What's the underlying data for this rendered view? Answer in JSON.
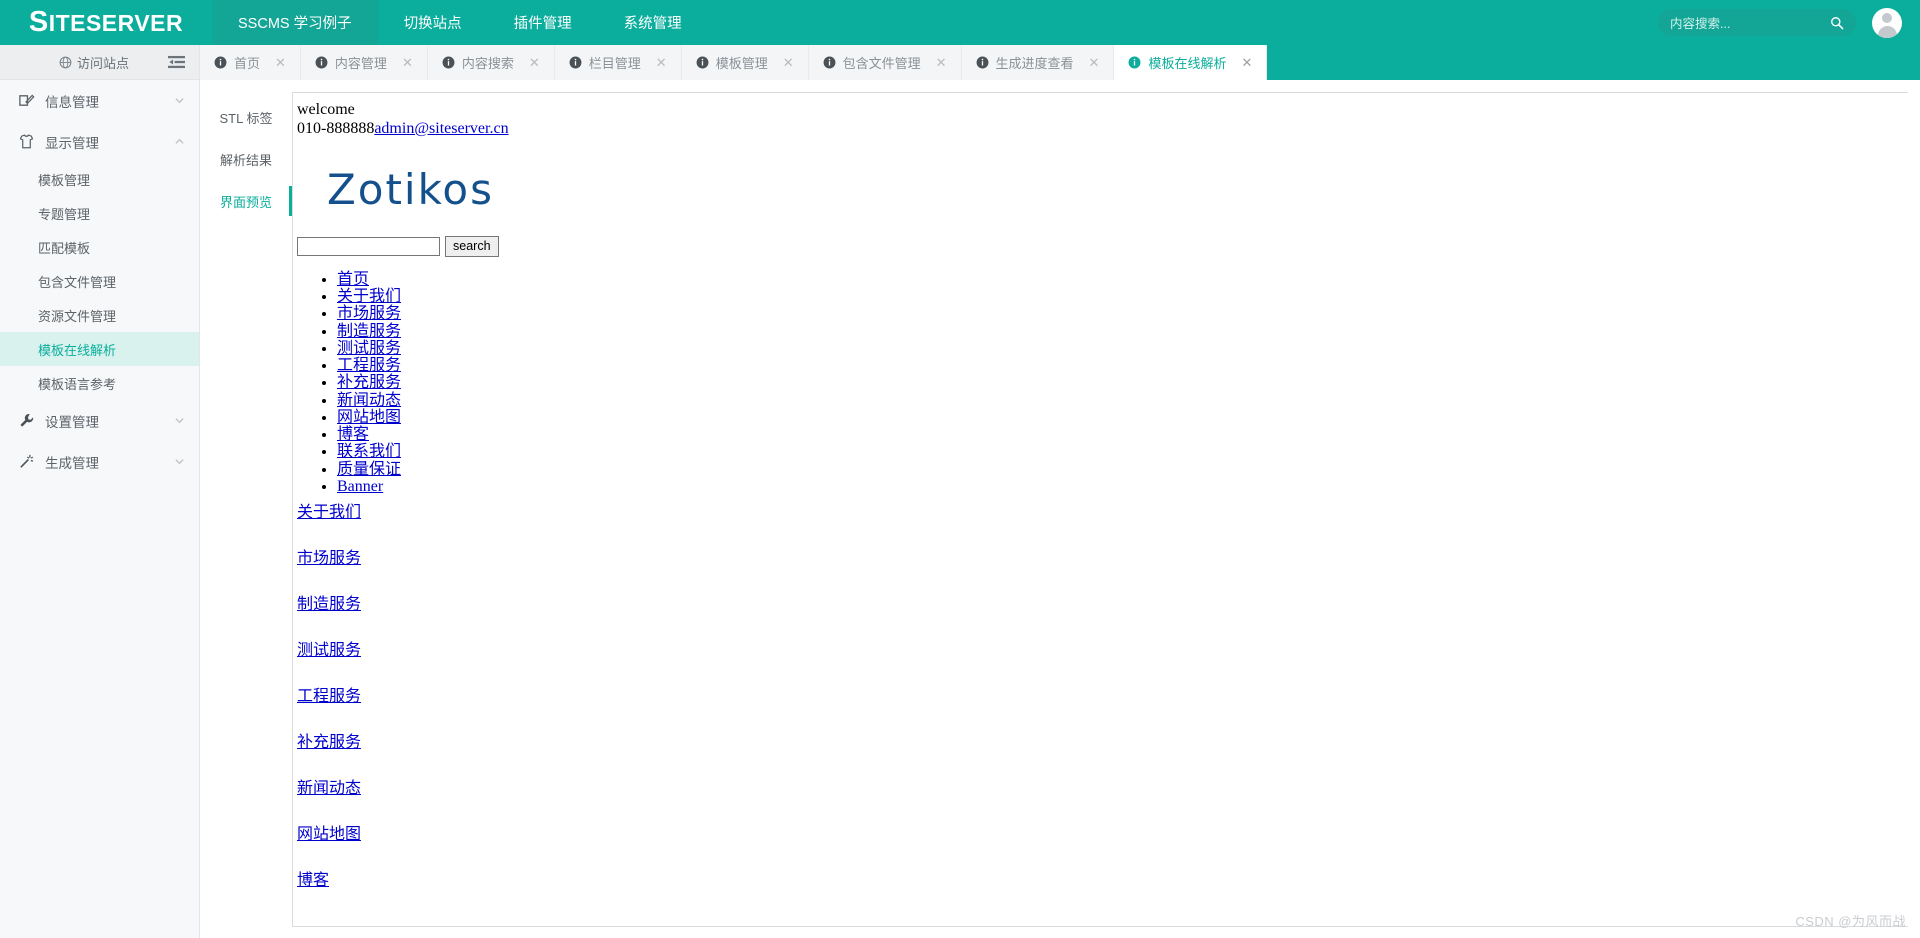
{
  "topbar": {
    "logo": "SITESERVER",
    "logo_first": "S",
    "logo_rest": "ITESERVER",
    "nav": [
      {
        "label": "SSCMS 学习例子",
        "active": true
      },
      {
        "label": "切换站点",
        "active": false
      },
      {
        "label": "插件管理",
        "active": false
      },
      {
        "label": "系统管理",
        "active": false
      }
    ],
    "search_placeholder": "内容搜索...",
    "search_icon": "search-icon",
    "avatar_icon": "avatar-icon"
  },
  "sidebar": {
    "visit_site": "访问站点",
    "visit_icon": "globe-icon",
    "collapse_icon": "collapse-menu-icon",
    "groups": [
      {
        "label": "信息管理",
        "icon": "edit-square-icon",
        "expanded": false,
        "chevron": "chevron-down-icon",
        "items": []
      },
      {
        "label": "显示管理",
        "icon": "shirt-icon",
        "expanded": true,
        "chevron": "chevron-up-icon",
        "items": [
          {
            "label": "模板管理",
            "active": false
          },
          {
            "label": "专题管理",
            "active": false
          },
          {
            "label": "匹配模板",
            "active": false
          },
          {
            "label": "包含文件管理",
            "active": false
          },
          {
            "label": "资源文件管理",
            "active": false
          },
          {
            "label": "模板在线解析",
            "active": true
          },
          {
            "label": "模板语言参考",
            "active": false
          }
        ]
      },
      {
        "label": "设置管理",
        "icon": "wrench-icon",
        "expanded": false,
        "chevron": "chevron-down-icon",
        "items": []
      },
      {
        "label": "生成管理",
        "icon": "magic-wand-icon",
        "expanded": false,
        "chevron": "chevron-down-icon",
        "items": []
      }
    ]
  },
  "tabs": [
    {
      "label": "首页",
      "active": false
    },
    {
      "label": "内容管理",
      "active": false
    },
    {
      "label": "内容搜索",
      "active": false
    },
    {
      "label": "栏目管理",
      "active": false
    },
    {
      "label": "模板管理",
      "active": false
    },
    {
      "label": "包含文件管理",
      "active": false
    },
    {
      "label": "生成进度查看",
      "active": false
    },
    {
      "label": "模板在线解析",
      "active": true
    }
  ],
  "vtabs": [
    {
      "label": "STL 标签",
      "active": false
    },
    {
      "label": "解析结果",
      "active": false
    },
    {
      "label": "界面预览",
      "active": true
    }
  ],
  "preview": {
    "welcome": "welcome",
    "phone": "010-888888",
    "email": "admin@siteserver.cn",
    "logo": "Zotikos",
    "search_value": "",
    "search_button": "search",
    "menu_items": [
      "首页",
      "关于我们",
      "市场服务",
      "制造服务",
      "测试服务",
      "工程服务",
      "补充服务",
      "新闻动态",
      "网站地图",
      "博客",
      "联系我们",
      "质量保证",
      "Banner"
    ],
    "section_links": [
      "关于我们",
      "市场服务",
      "制造服务",
      "测试服务",
      "工程服务",
      "补充服务",
      "新闻动态",
      "网站地图",
      "博客"
    ]
  },
  "watermark": "CSDN @为风而战",
  "colors": {
    "brand_teal": "#0bae9c",
    "brand_teal_dark": "#13a596",
    "active_nav_bg": "#d9f2ee",
    "link_blue": "#0000cc",
    "logo_blue": "#14508c"
  }
}
